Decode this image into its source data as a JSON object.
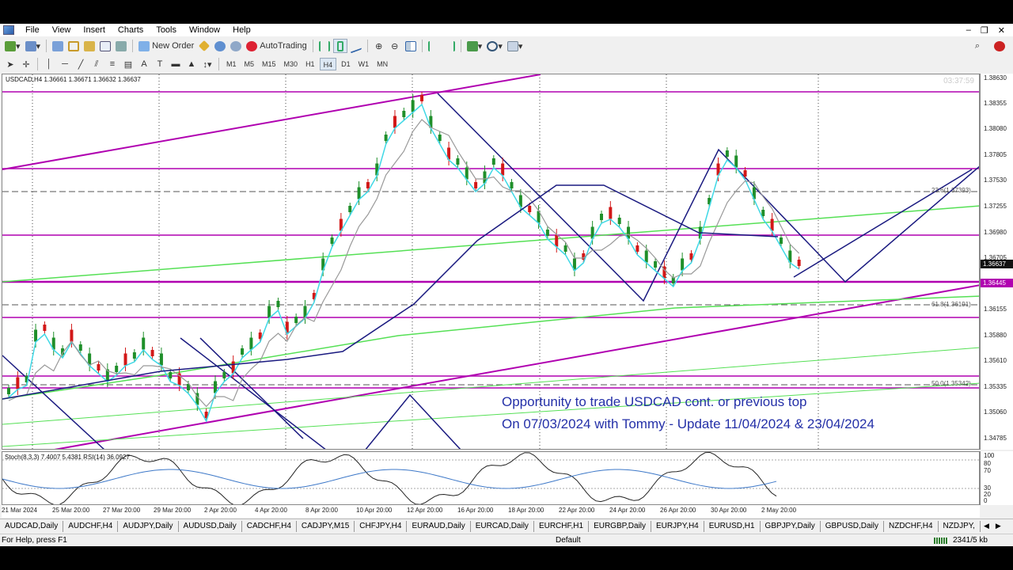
{
  "menu": {
    "items": [
      "File",
      "View",
      "Insert",
      "Charts",
      "Tools",
      "Window",
      "Help"
    ]
  },
  "toolbar": {
    "new_order": "New Order",
    "autotrading": "AutoTrading",
    "timeframes": [
      "M1",
      "M5",
      "M15",
      "M30",
      "H1",
      "H4",
      "D1",
      "W1",
      "MN"
    ],
    "active_timeframe": "H4"
  },
  "chart": {
    "header": "USDCAD,H4  1.36661 1.36671 1.36632 1.36637",
    "clock": "03:37:59",
    "price_labels": [
      "1.38630",
      "1.38355",
      "1.38080",
      "1.37805",
      "1.37530",
      "1.37255",
      "1.36980",
      "1.36705",
      "1.36430",
      "1.36155",
      "1.35880",
      "1.35610",
      "1.35335",
      "1.35060",
      "1.34785"
    ],
    "current_price": "1.36637",
    "level_price": "1.36445",
    "fib_labels": [
      "23.6(1.37393)",
      "61.8(1.36191)",
      "50.0(1.35342)"
    ],
    "time_labels": [
      "21 Mar 2024",
      "25 Mar 20:00",
      "27 Mar 20:00",
      "29 Mar 20:00",
      "2 Apr 20:00",
      "4 Apr 20:00",
      "8 Apr 20:00",
      "10 Apr 20:00",
      "12 Apr 20:00",
      "16 Apr 20:00",
      "18 Apr 20:00",
      "22 Apr 20:00",
      "24 Apr 20:00",
      "26 Apr 20:00",
      "30 Apr 20:00",
      "2 May 20:00"
    ],
    "annotation_line1": "Opportunity to trade USDCAD cont. or previous top",
    "annotation_line2": "On 07/03/2024 with Tommy - Update 11/04/2024 & 23/04/2024"
  },
  "subwindow": {
    "header": "Stoch(8,3,3) 7.4007 5.4381  RSI(14) 36.0927",
    "scale": [
      "100",
      "80",
      "70",
      "30",
      "20",
      "0"
    ]
  },
  "tabs": [
    "AUDCAD,Daily",
    "AUDCHF,H4",
    "AUDJPY,Daily",
    "AUDUSD,Daily",
    "CADCHF,H4",
    "CADJPY,M15",
    "CHFJPY,H4",
    "EURAUD,Daily",
    "EURCAD,Daily",
    "EURCHF,H1",
    "EURGBP,Daily",
    "EURJPY,H4",
    "EURUSD,H1",
    "GBPJPY,Daily",
    "GBPUSD,Daily",
    "NZDCHF,H4",
    "NZDJPY,"
  ],
  "status": {
    "help": "For Help, press F1",
    "profile": "Default",
    "traffic": "2341/5 kb"
  },
  "colors": {
    "magenta": "#b000b0",
    "navy": "#1a1a80",
    "green": "#33dd33",
    "cyan": "#3fd8e6",
    "bull": "#1f8f2a",
    "bear": "#d21818"
  }
}
